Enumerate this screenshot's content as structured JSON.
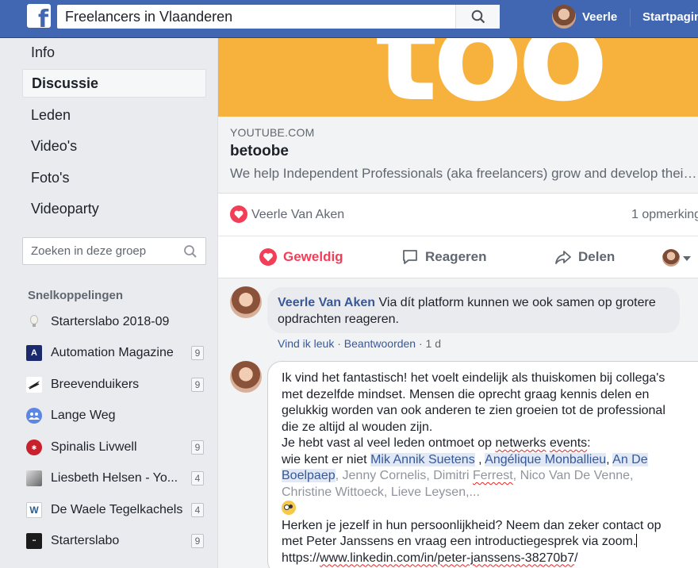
{
  "topbar": {
    "logo_glyph": "f",
    "search_value": "Freelancers in Vlaanderen",
    "user_name": "Veerle",
    "home_label": "Startpagina"
  },
  "sidebar": {
    "nav": [
      {
        "label": "Info",
        "active": false
      },
      {
        "label": "Discussie",
        "active": true
      },
      {
        "label": "Leden",
        "active": false
      },
      {
        "label": "Video's",
        "active": false
      },
      {
        "label": "Foto's",
        "active": false
      },
      {
        "label": "Videoparty",
        "active": false
      }
    ],
    "group_search_placeholder": "Zoeken in deze groep",
    "shortcuts_title": "Snelkoppelingen",
    "shortcuts": [
      {
        "label": "Starterslabo 2018-09",
        "badge": "",
        "icon": "lightbulb-icon"
      },
      {
        "label": "Automation Magazine",
        "badge": "9",
        "icon": "automation-logo-icon"
      },
      {
        "label": "Breevenduikers",
        "badge": "9",
        "icon": "diver-icon"
      },
      {
        "label": "Lange Weg",
        "badge": "",
        "icon": "group-icon"
      },
      {
        "label": "Spinalis Livwell",
        "badge": "9",
        "icon": "spinalis-logo-icon"
      },
      {
        "label": "Liesbeth Helsen - Yo...",
        "badge": "4",
        "icon": "yoga-photo-icon"
      },
      {
        "label": "De Waele Tegelkachels",
        "badge": "4",
        "icon": "dewaele-logo-icon"
      },
      {
        "label": "Starterslabo",
        "badge": "9",
        "icon": "starterslabo-logo-icon"
      }
    ]
  },
  "post": {
    "banner_text": "too",
    "domain": "YOUTUBE.COM",
    "title": "betoobe",
    "description": "We help Independent Professionals (aka freelancers) grow and develop their business",
    "reactor": "Veerle Van Aken",
    "comment_count": "1 opmerking",
    "actions": {
      "love": "Geweldig",
      "comment": "Reageren",
      "share": "Delen"
    }
  },
  "comment": {
    "author": "Veerle Van Aken",
    "text": "Via dít platform kunnen we ook samen op grotere opdrachten reageren.",
    "like": "Vind ik leuk",
    "reply": "Beantwoorden",
    "time": "1 d"
  },
  "draft": {
    "line1": "Ik vind het fantastisch! het voelt eindelijk als thuiskomen bij collega's",
    "line2": "met dezelfde mindset. Mensen die oprecht graag kennis delen en",
    "line3": "gelukkig worden van ook anderen te zien groeien tot de professional",
    "line4": "die ze altijd al wouden zijn.",
    "line5_a": "Je hebt vast al veel leden ontmoet op ",
    "line5_w1": "netwerks",
    "line5_sp": " ",
    "line5_w2": "events",
    "line5_b": ":",
    "line6_a": "wie kent er niet ",
    "mention1": "Mik Annik Suetens",
    "line6_b": " , ",
    "mention2": "Angélique Monballieu",
    "line6_c": ",  ",
    "mention3a": "An De",
    "mention3b": "Boelpaep",
    "line7_a": ", Jenny Cornelis, Dimitri ",
    "line7_w": "Ferrest",
    "line7_b": ", Nico Van De Venne,",
    "line8": "Christine Wittoeck, Lieve Leysen,...",
    "line9": "Herken je jezelf in hun persoonlijkheid? Neem dan zeker contact op",
    "line10": "met Peter Janssens en vraag een introductiegesprek via zoom.",
    "line11_a": "https://",
    "line11_link": "www.linkedin.com/in/peter-janssens-38270b7",
    "line11_b": "/"
  }
}
